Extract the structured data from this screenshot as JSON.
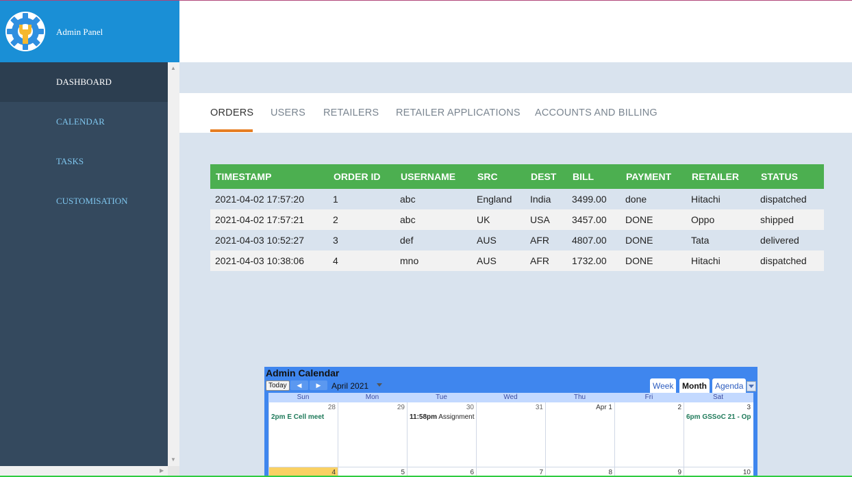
{
  "brand": {
    "title": "Admin Panel"
  },
  "sidebar": {
    "items": [
      {
        "label": "DASHBOARD"
      },
      {
        "label": "CALENDAR"
      },
      {
        "label": "TASKS"
      },
      {
        "label": "CUSTOMISATION"
      }
    ]
  },
  "tabs": [
    {
      "label": "ORDERS"
    },
    {
      "label": "USERS"
    },
    {
      "label": "RETAILERS"
    },
    {
      "label": "RETAILER APPLICATIONS"
    },
    {
      "label": "ACCOUNTS AND BILLING"
    }
  ],
  "orders": {
    "columns": [
      "TIMESTAMP",
      "ORDER ID",
      "USERNAME",
      "SRC",
      "DEST",
      "BILL",
      "PAYMENT",
      "RETAILER",
      "STATUS"
    ],
    "rows": [
      [
        "2021-04-02 17:57:20",
        "1",
        "abc",
        "England",
        "India",
        "3499.00",
        "done",
        "Hitachi",
        "dispatched"
      ],
      [
        "2021-04-02 17:57:21",
        "2",
        "abc",
        "UK",
        "USA",
        "3457.00",
        "DONE",
        "Oppo",
        "shipped"
      ],
      [
        "2021-04-03 10:52:27",
        "3",
        "def",
        "AUS",
        "AFR",
        "4807.00",
        "DONE",
        "Tata",
        "delivered"
      ],
      [
        "2021-04-03 10:38:06",
        "4",
        "mno",
        "AUS",
        "AFR",
        "1732.00",
        "DONE",
        "Hitachi",
        "dispatched"
      ]
    ]
  },
  "calendar": {
    "title": "Admin Calendar",
    "today_label": "Today",
    "month_label": "April 2021",
    "views": [
      "Week",
      "Month",
      "Agenda"
    ],
    "weekdays": [
      "Sun",
      "Mon",
      "Tue",
      "Wed",
      "Thu",
      "Fri",
      "Sat"
    ],
    "week1": [
      "28",
      "29",
      "30",
      "31",
      "Apr 1",
      "2",
      "3"
    ],
    "week2": [
      "4",
      "5",
      "6",
      "7",
      "8",
      "9",
      "10"
    ],
    "events": {
      "sun": "2pm E Cell meet",
      "tue_time": "11:58pm",
      "tue_title": "Assignment",
      "sat": "6pm GSSoC 21 - Op"
    }
  },
  "colors": {
    "brand": "#1a8fd6",
    "sidebar": "#34495e",
    "table_header": "#4caf50",
    "tab_accent": "#e67e22",
    "calendar": "#3f86ee"
  }
}
